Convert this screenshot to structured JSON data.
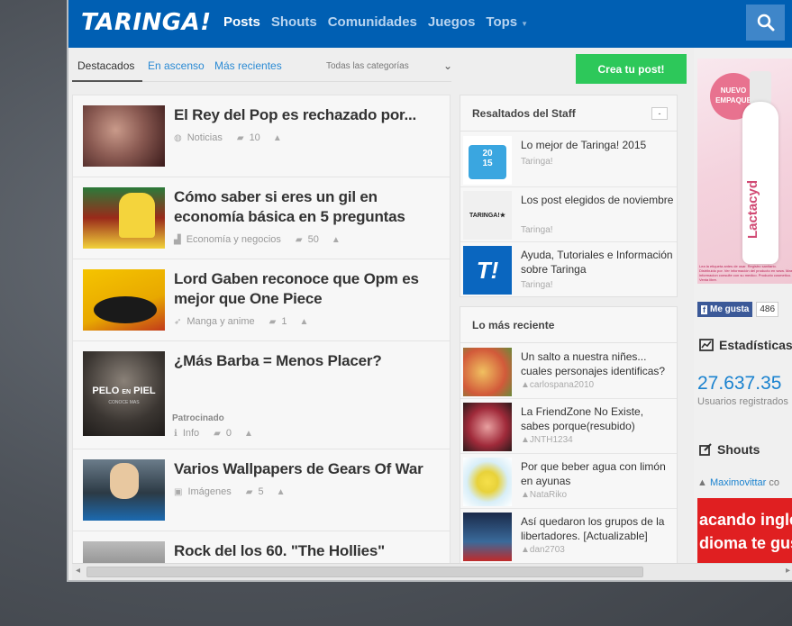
{
  "header": {
    "logo": "TARINGA!",
    "nav": [
      {
        "label": "Posts",
        "active": true
      },
      {
        "label": "Shouts"
      },
      {
        "label": "Comunidades"
      },
      {
        "label": "Juegos"
      },
      {
        "label": "Tops"
      }
    ],
    "brand_color": "#005fb3"
  },
  "tabs": {
    "items": [
      "Destacados",
      "En ascenso",
      "Más recientes"
    ],
    "active": "Destacados",
    "category_select": "Todas las categorías"
  },
  "create_button": "Crea tu post!",
  "posts": [
    {
      "title": "El Rey del Pop es rechazado por...",
      "category": "Noticias",
      "comments": "10"
    },
    {
      "title": "Cómo saber si eres un gil en economía básica en 5 preguntas",
      "category": "Economía y negocios",
      "comments": "50"
    },
    {
      "title": "Lord Gaben reconoce que Opm es mejor que One Piece",
      "category": "Manga y anime",
      "comments": "1"
    },
    {
      "title": "¿Más Barba = Menos Placer?",
      "sponsored": "Patrocinado",
      "category": "Info",
      "comments": "0",
      "thumb_text_1": "PELO",
      "thumb_text_2": "PIEL",
      "thumb_text_small": "EN",
      "thumb_caption": "CONOCE MAS"
    },
    {
      "title": "Varios Wallpapers de Gears Of War",
      "category": "Imágenes",
      "comments": "5"
    },
    {
      "title": "Rock del los 60. \"The Hollies\""
    }
  ],
  "staff": {
    "title": "Resaltados del Staff",
    "collapse": "-",
    "items": [
      {
        "title": "Lo mejor de Taringa! 2015",
        "sub": "Taringa!",
        "thumb_a": "20",
        "thumb_b": "15"
      },
      {
        "title": "Los post elegidos de noviembre",
        "sub": "Taringa!",
        "thumb_text": "TARINGA!★"
      },
      {
        "title": "Ayuda, Tutoriales e Información sobre Taringa",
        "sub": "Taringa!",
        "thumb_text": "T!"
      }
    ]
  },
  "recent": {
    "title": "Lo más reciente",
    "items": [
      {
        "title": "Un salto a nuestra niñes... cuales personajes identificas?",
        "user": "carlospana2010"
      },
      {
        "title": "La FriendZone No Existe, sabes porque(resubido)",
        "user": "JNTH1234"
      },
      {
        "title": "Por que beber agua con limón en ayunas",
        "user": "NataRiko"
      },
      {
        "title": "Así quedaron los grupos de la libertadores. [Actualizable]",
        "user": "dan2703"
      }
    ]
  },
  "ad": {
    "badge": "NUEVO EMPAQUE",
    "brand": "Lactacyd",
    "fine": "Lea la etiqueta antes de usar. Registro sanitario. Distribuido por. Ver información del producto en www. Mas informacion consulte con su medico. Producto cosmetico. Venta libre."
  },
  "facebook": {
    "label": "Me gusta",
    "icon": "f",
    "count": "486"
  },
  "stats": {
    "title": "Estadísticas",
    "number": "27.637.35",
    "sub": "Usuarios registrados"
  },
  "shouts": {
    "title": "Shouts",
    "user": "Maximovittar",
    "cont": "co",
    "image_line1": "acando ingle",
    "image_line2": "dioma te gus"
  }
}
